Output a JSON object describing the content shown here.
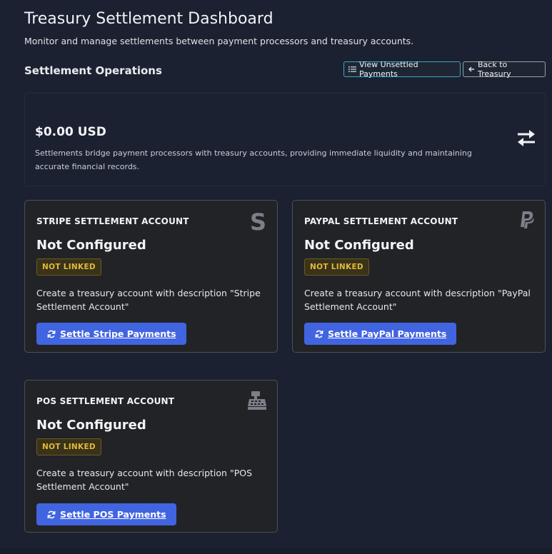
{
  "header": {
    "title": "Treasury Settlement Dashboard",
    "subtitle": "Monitor and manage settlements between payment processors and treasury accounts."
  },
  "operations": {
    "title": "Settlement Operations",
    "view_unsettled_label": "View Unsettled Payments",
    "back_label": "Back to Treasury"
  },
  "summary": {
    "amount": "$0.00 USD",
    "description": "Settlements bridge payment processors with treasury accounts, providing immediate liquidity and maintaining accurate financial records.",
    "icon": "exchange-arrows-icon"
  },
  "accounts": [
    {
      "title": "STRIPE SETTLEMENT ACCOUNT",
      "status": "Not Configured",
      "badge": "NOT LINKED",
      "description": "Create a treasury account with description \"Stripe Settlement Account\"",
      "button_label": "Settle Stripe Payments",
      "icon": "stripe-icon"
    },
    {
      "title": "PAYPAL SETTLEMENT ACCOUNT",
      "status": "Not Configured",
      "badge": "NOT LINKED",
      "description": "Create a treasury account with description \"PayPal Settlement Account\"",
      "button_label": "Settle PayPal Payments",
      "icon": "paypal-icon"
    },
    {
      "title": "POS SETTLEMENT ACCOUNT",
      "status": "Not Configured",
      "badge": "NOT LINKED",
      "description": "Create a treasury account with description \"POS Settlement Account\"",
      "button_label": "Settle POS Payments",
      "icon": "cash-register-icon"
    }
  ],
  "colors": {
    "background": "#1b2130",
    "card": "#212327",
    "primary_button": "#4164e0",
    "badge_text": "#e2b93b",
    "info_outline": "#3aa8c1"
  }
}
